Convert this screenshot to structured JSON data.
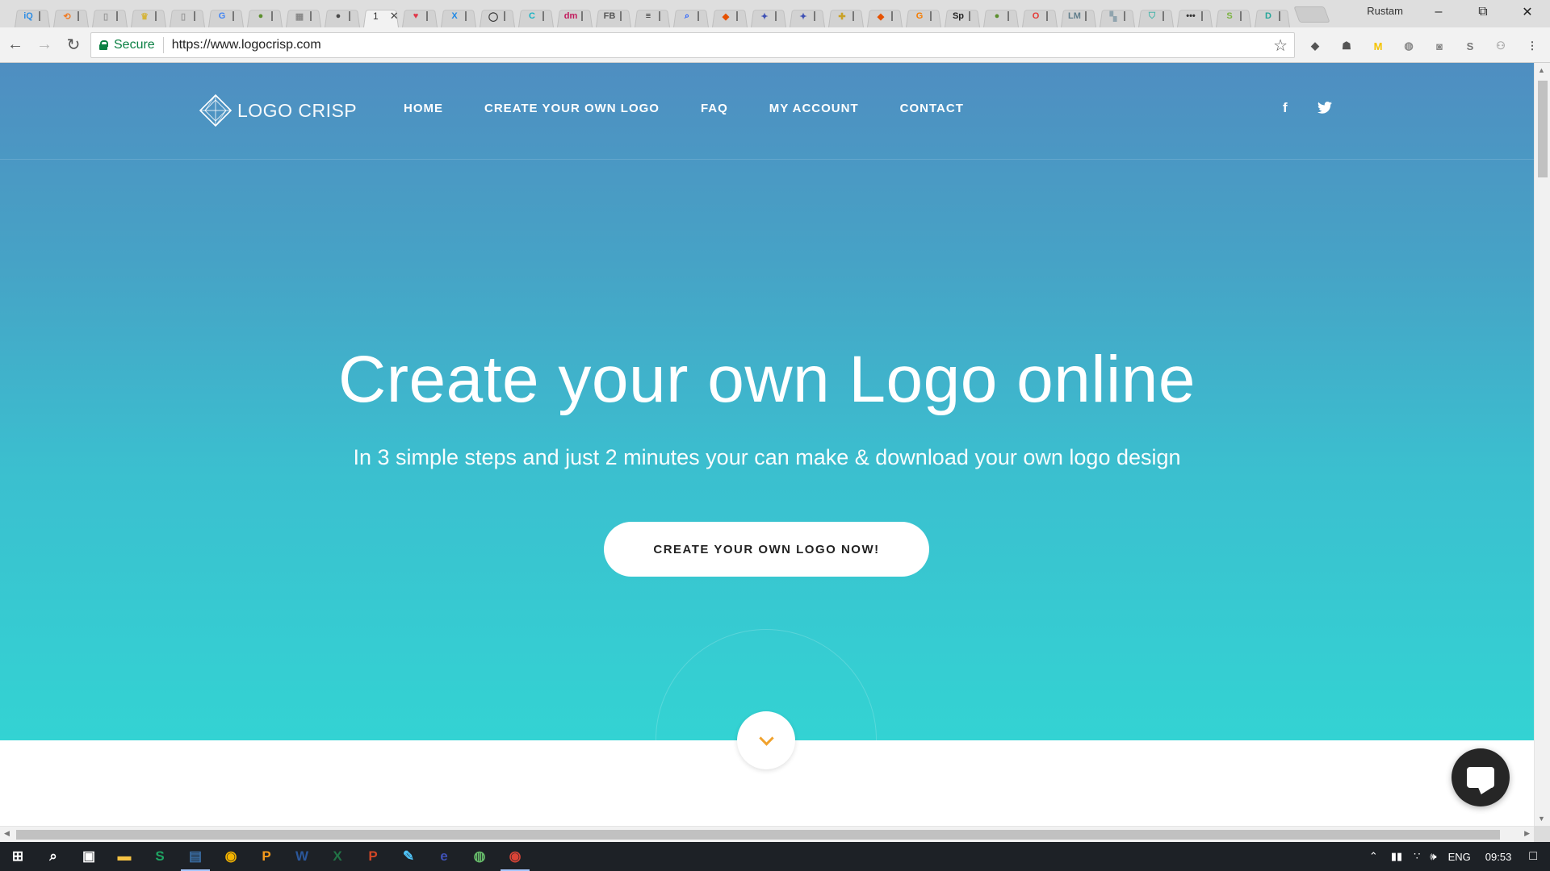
{
  "browser": {
    "profile_name": "Rustam",
    "active_tab_number": "1",
    "security_label": "Secure",
    "url": "https://www.logocrisp.com",
    "tabs": [
      {
        "icon": "iq-icon",
        "glyph": "iQ",
        "color": "#2e8de4"
      },
      {
        "icon": "link-icon",
        "glyph": "⟲",
        "color": "#f07a22"
      },
      {
        "icon": "doc-icon",
        "glyph": "▯",
        "color": "#9a9a9a"
      },
      {
        "icon": "crown-icon",
        "glyph": "♛",
        "color": "#d5b43a"
      },
      {
        "icon": "doc-icon",
        "glyph": "▯",
        "color": "#9a9a9a"
      },
      {
        "icon": "google-icon",
        "glyph": "G",
        "color": "#4285f4"
      },
      {
        "icon": "leaf-icon",
        "glyph": "●",
        "color": "#5c8f2e"
      },
      {
        "icon": "grid-icon",
        "glyph": "▦",
        "color": "#888888"
      },
      {
        "icon": "orb-icon",
        "glyph": "●",
        "color": "#4a4a4a"
      },
      {
        "icon": "active-tab",
        "glyph": "",
        "color": "#f2f2f2"
      },
      {
        "icon": "heart-icon",
        "glyph": "♥",
        "color": "#e0394b"
      },
      {
        "icon": "x-icon",
        "glyph": "X",
        "color": "#1e88e5"
      },
      {
        "icon": "ring-icon",
        "glyph": "◯",
        "color": "#333333"
      },
      {
        "icon": "c-icon",
        "glyph": "C",
        "color": "#19b3c4"
      },
      {
        "icon": "dm-icon",
        "glyph": "dm",
        "color": "#c2185b"
      },
      {
        "icon": "flb-icon",
        "glyph": "FB",
        "color": "#555555"
      },
      {
        "icon": "book-icon",
        "glyph": "≡",
        "color": "#222222"
      },
      {
        "icon": "search-tool-icon",
        "glyph": "⌕",
        "color": "#2962ff"
      },
      {
        "icon": "shape-icon",
        "glyph": "◆",
        "color": "#e65100"
      },
      {
        "icon": "bird-icon",
        "glyph": "✦",
        "color": "#3f51b5"
      },
      {
        "icon": "bird-icon",
        "glyph": "✦",
        "color": "#3f51b5"
      },
      {
        "icon": "puzzle-icon",
        "glyph": "✚",
        "color": "#c9a227"
      },
      {
        "icon": "shape-icon",
        "glyph": "◆",
        "color": "#e65100"
      },
      {
        "icon": "g-icon",
        "glyph": "G",
        "color": "#f57c00"
      },
      {
        "icon": "sp-icon",
        "glyph": "Sp",
        "color": "#222222"
      },
      {
        "icon": "leaf-icon",
        "glyph": "●",
        "color": "#5c8f2e"
      },
      {
        "icon": "opera-icon",
        "glyph": "O",
        "color": "#e53935"
      },
      {
        "icon": "lm-icon",
        "glyph": "LM",
        "color": "#607d8b"
      },
      {
        "icon": "pixel-icon",
        "glyph": "▚",
        "color": "#90a4ae"
      },
      {
        "icon": "shield-icon",
        "glyph": "⛉",
        "color": "#4db6ac"
      },
      {
        "icon": "more-icon",
        "glyph": "•••",
        "color": "#333333"
      },
      {
        "icon": "shopify-icon",
        "glyph": "S",
        "color": "#7cb342"
      },
      {
        "icon": "d-icon",
        "glyph": "D",
        "color": "#26a69a"
      }
    ],
    "extensions": [
      {
        "icon": "pocket-icon",
        "glyph": "◆",
        "color": "#555555"
      },
      {
        "icon": "ghostery-icon",
        "glyph": "☗",
        "color": "#555555"
      },
      {
        "icon": "m-icon",
        "glyph": "M",
        "color": "#f5c400"
      },
      {
        "icon": "globe-icon",
        "glyph": "◍",
        "color": "#888888"
      },
      {
        "icon": "camera-icon",
        "glyph": "◙",
        "color": "#888888"
      },
      {
        "icon": "s-ext-icon",
        "glyph": "S",
        "color": "#777777"
      },
      {
        "icon": "person-icon",
        "glyph": "⚇",
        "color": "#aaaaaa"
      },
      {
        "icon": "menu-dots-icon",
        "glyph": "⋮",
        "color": "#555555"
      }
    ]
  },
  "site": {
    "brand_name": "LOGO CRISP",
    "nav": [
      "HOME",
      "CREATE YOUR OWN LOGO",
      "FAQ",
      "MY ACCOUNT",
      "CONTACT"
    ],
    "social": {
      "facebook": "f",
      "twitter": "t"
    },
    "headline": "Create your own Logo online",
    "subheadline": "In 3 simple steps and just 2 minutes your can make & download your own logo design",
    "cta_label": "CREATE YOUR OWN LOGO NOW!",
    "accent_color": "#f0a22e"
  },
  "taskbar": {
    "language": "ENG",
    "time": "09:53",
    "apps": [
      {
        "icon": "start-icon",
        "glyph": "⊞",
        "color": "#ffffff"
      },
      {
        "icon": "search-icon",
        "glyph": "⌕",
        "color": "#ffffff"
      },
      {
        "icon": "task-view-icon",
        "glyph": "▣",
        "color": "#ffffff"
      },
      {
        "icon": "file-explorer-icon",
        "glyph": "▬",
        "color": "#f6c343"
      },
      {
        "icon": "s-app-icon",
        "glyph": "S",
        "color": "#1fa463"
      },
      {
        "icon": "photo-app-icon",
        "glyph": "▤",
        "color": "#3a6ea5"
      },
      {
        "icon": "chrome-canary-icon",
        "glyph": "◉",
        "color": "#f4b400"
      },
      {
        "icon": "p-app-icon",
        "glyph": "P",
        "color": "#f59a1c"
      },
      {
        "icon": "word-icon",
        "glyph": "W",
        "color": "#2b579a"
      },
      {
        "icon": "excel-icon",
        "glyph": "X",
        "color": "#217346"
      },
      {
        "icon": "powerpoint-icon",
        "glyph": "P",
        "color": "#d24726"
      },
      {
        "icon": "pen-app-icon",
        "glyph": "✎",
        "color": "#4fc3f7"
      },
      {
        "icon": "e-app-icon",
        "glyph": "e",
        "color": "#3f51b5"
      },
      {
        "icon": "globe-app-icon",
        "glyph": "◍",
        "color": "#66bb6a"
      },
      {
        "icon": "chrome-icon",
        "glyph": "◉",
        "color": "#db4437"
      }
    ]
  }
}
